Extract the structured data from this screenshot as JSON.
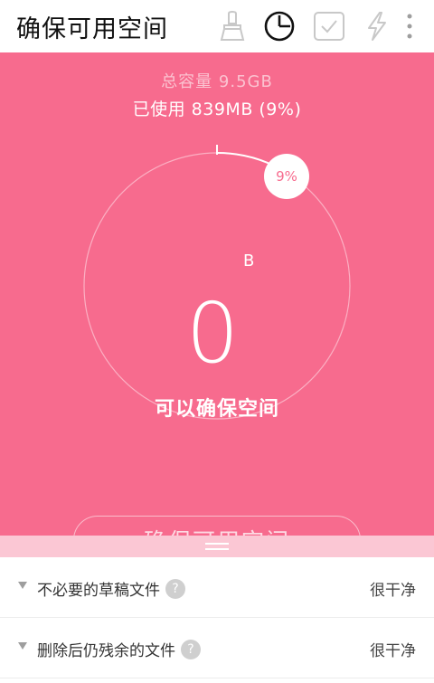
{
  "header": {
    "title": "确保可用空间",
    "icons": [
      "broom-icon",
      "pie-chart-icon",
      "checkbox-icon",
      "lightning-icon",
      "more-vert-icon"
    ]
  },
  "storage": {
    "total": "总容量 9.5GB",
    "used": "已使用 839MB (9%)",
    "used_fraction": 0.09,
    "badge": "9%",
    "value": "0",
    "unit": "B",
    "caption": "可以确保空间"
  },
  "action": {
    "label": "确保可用空间"
  },
  "list": [
    {
      "label": "不必要的草稿文件",
      "help": "?",
      "status": "很干净"
    },
    {
      "label": "删除后仍残余的文件",
      "help": "?",
      "status": "很干净"
    }
  ],
  "colors": {
    "accent": "#f76b8e",
    "strip": "#fbc7d4"
  }
}
